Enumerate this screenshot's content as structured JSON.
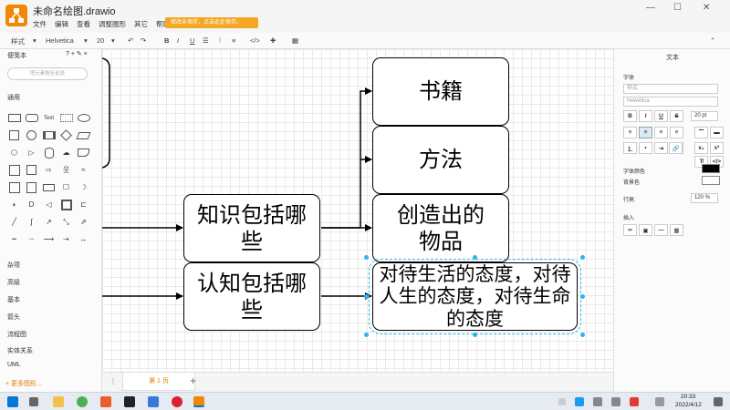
{
  "window": {
    "title": "未命名绘图.drawio",
    "save_notice": "修改未保存，点击此处保存。"
  },
  "menu": [
    "文件",
    "编辑",
    "查看",
    "调整图形",
    "其它",
    "帮助"
  ],
  "toolbar": {
    "style_label": "样式",
    "font": "Helvetica",
    "font_size": "20"
  },
  "sidebar": {
    "scratchpad": "便笺本",
    "search_placeholder": "把元素拖至此处",
    "general": "通用",
    "sections": [
      "杂项",
      "高级",
      "基本",
      "箭头",
      "流程图",
      "实体关系",
      "UML"
    ],
    "more_shapes": "+ 更多图形..."
  },
  "diagram": {
    "left_nodes": [
      {
        "label": "知识包括哪些"
      },
      {
        "label": "认知包括哪些"
      }
    ],
    "right_nodes": [
      {
        "label": "书籍"
      },
      {
        "label": "方法"
      },
      {
        "label": "创造出的物品"
      },
      {
        "label": "对待生活的态度，对待人生的态度，对待生命的态度"
      }
    ]
  },
  "pages": {
    "current": "第 1 页"
  },
  "format_panel": {
    "title": "文本",
    "font_label": "字体",
    "font_style_placeholder": "样式",
    "font_family": "Helvetica",
    "font_size": "20 pt",
    "font_color_label": "字体颜色",
    "bg_color_label": "背景色",
    "line_spacing_label": "行高",
    "line_spacing": "120 %",
    "insert_label": "插入"
  },
  "taskbar": {
    "time": "20:33",
    "date": "2022/4/12"
  },
  "colors": {
    "accent": "#f08705",
    "selection": "#29b6f2"
  }
}
